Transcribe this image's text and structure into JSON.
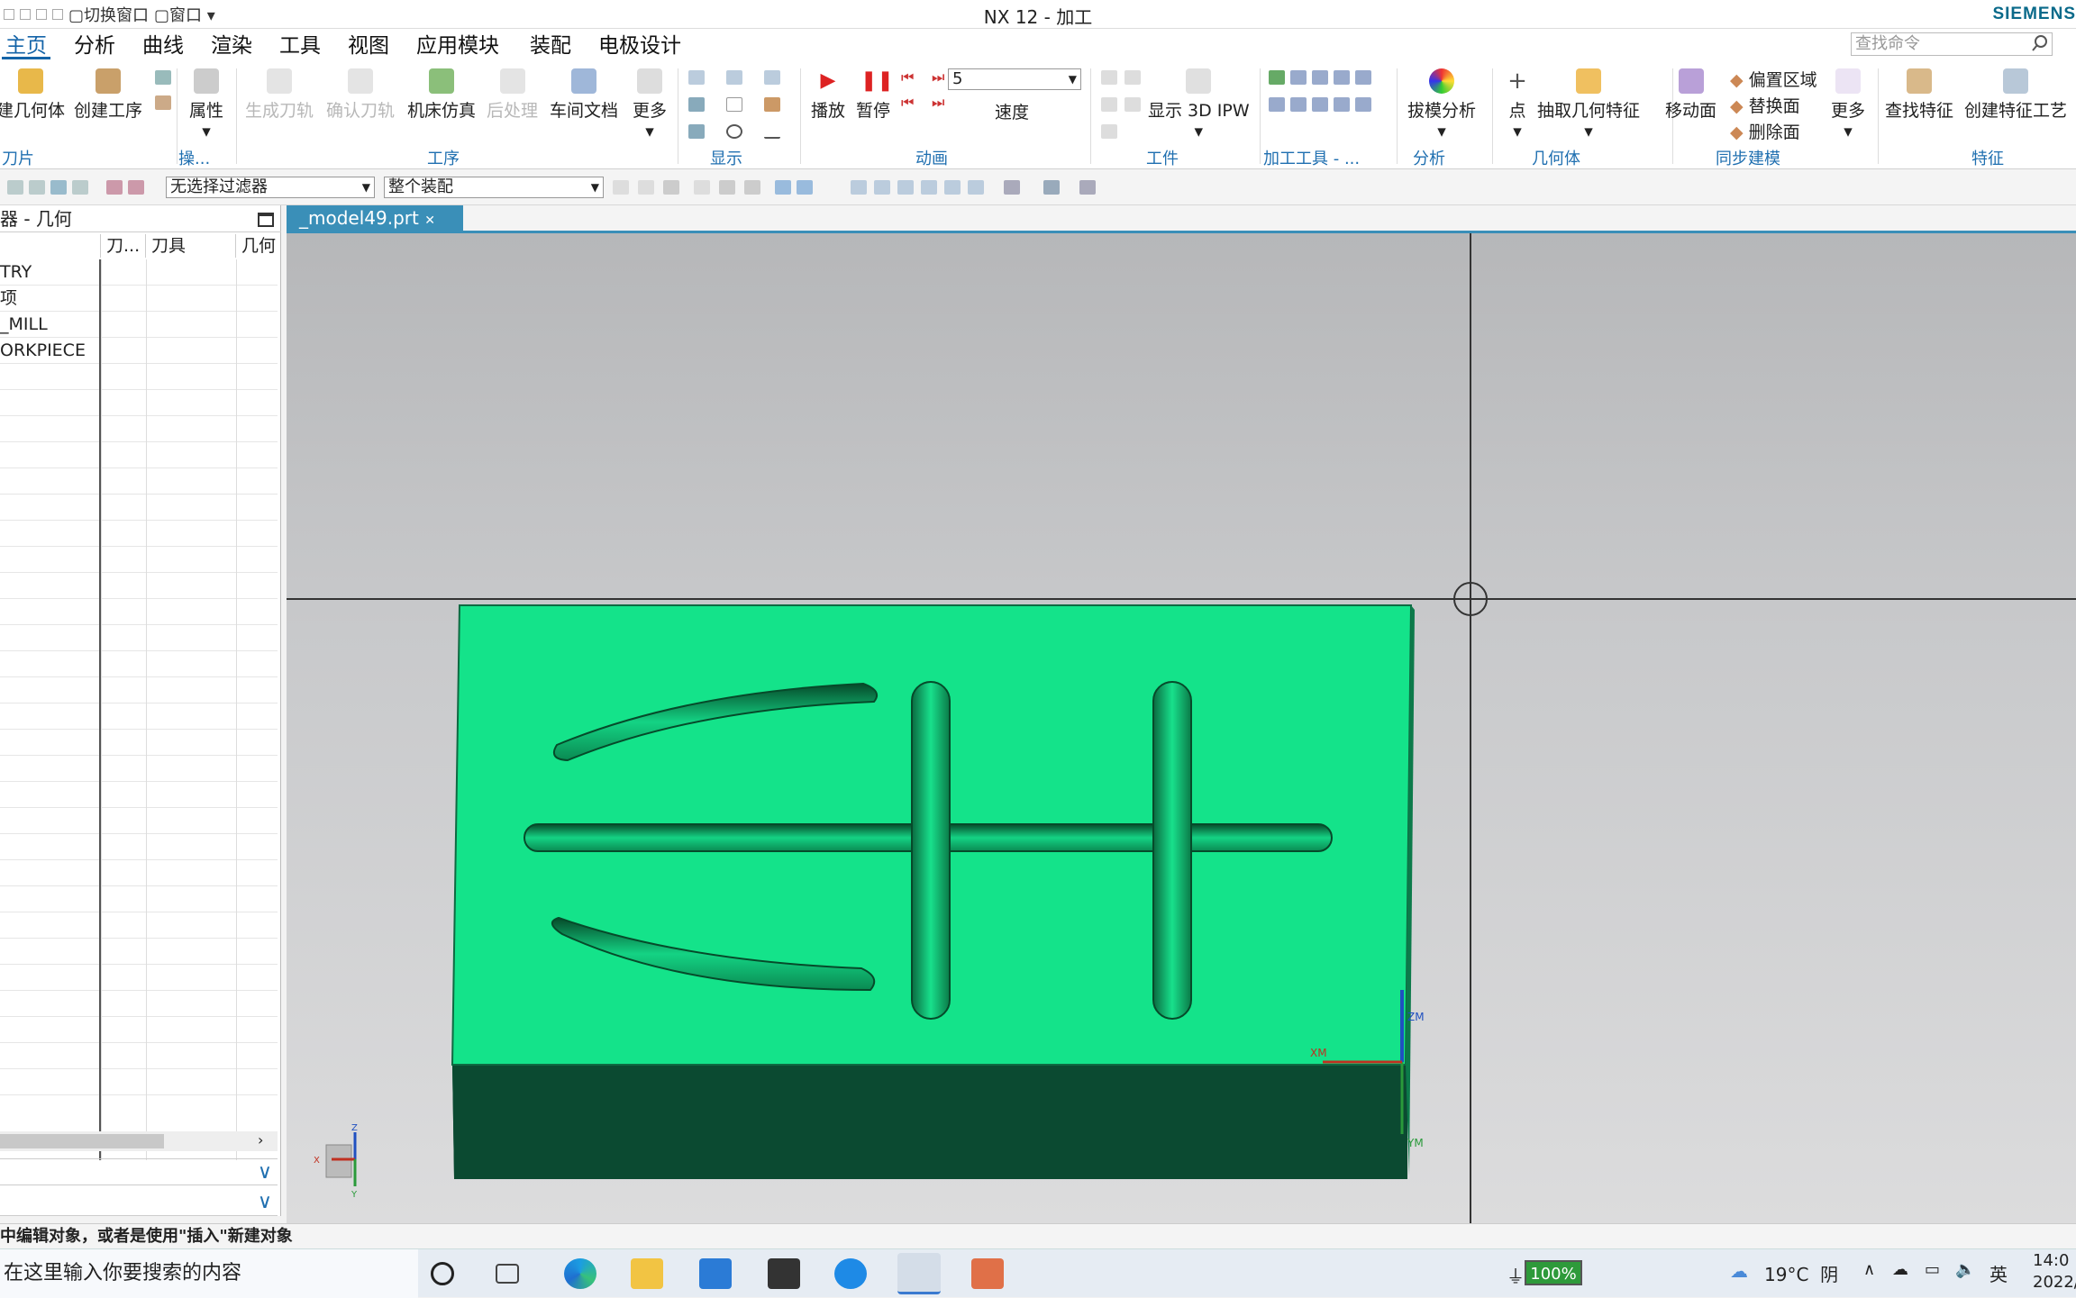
{
  "app": {
    "title": "NX 12 - 加工",
    "brand": "SIEMENS"
  },
  "qat": {
    "switch_window": "切换窗口",
    "window": "窗口"
  },
  "menu": {
    "items": [
      "主页",
      "分析",
      "曲线",
      "渲染",
      "工具",
      "视图",
      "应用模块",
      "装配",
      "电极设计"
    ],
    "search_placeholder": "查找命令"
  },
  "ribbon": {
    "buttons": {
      "create_geometry": "建几何体",
      "create_operation": "创建工序",
      "properties": "属性",
      "generate_path": "生成刀轨",
      "verify_path": "确认刀轨",
      "machine_sim": "机床仿真",
      "postprocess": "后处理",
      "shop_doc": "车间文档",
      "more": "更多",
      "play": "播放",
      "pause": "暂停",
      "speed_value": "5",
      "speed": "速度",
      "show_3d_ipw": "显示 3D IPW",
      "draft_analysis": "拔模分析",
      "point": "点",
      "extract_geometry": "抽取几何特征",
      "move_face": "移动面",
      "offset_region": "偏置区域",
      "replace_face": "替换面",
      "delete_face": "删除面",
      "more2": "更多",
      "find_feature": "查找特征",
      "create_feature_process": "创建特征工艺"
    },
    "groups": {
      "tool": "刀片",
      "ops": "操...",
      "operation": "工序",
      "display": "显示",
      "animation": "动画",
      "workpiece": "工件",
      "machining_tools": "加工工具 - ...",
      "analysis": "分析",
      "geometry": "几何体",
      "sync_modeling": "同步建模",
      "feature": "特征"
    }
  },
  "toolbar2": {
    "filter": "无选择过滤器",
    "assembly": "整个装配"
  },
  "navigator": {
    "title": "器 - 几何",
    "columns": [
      "刀...",
      "刀具",
      "几何"
    ],
    "rows": [
      "TRY",
      "项",
      "_MILL",
      "ORKPIECE"
    ]
  },
  "document": {
    "tab": "_model49.prt"
  },
  "viewport": {
    "wcs_labels": {
      "xm": "XM",
      "ym": "YM",
      "zm": "ZM"
    },
    "triad": {
      "x": "X",
      "y": "Y",
      "z": "Z"
    },
    "colors": {
      "part_top": "#14e38a",
      "part_side": "#0a4a30",
      "bg": "#c8c9cb"
    }
  },
  "status": {
    "prompt": "中编辑对象，或者是使用\"插入\"新建对象"
  },
  "taskbar": {
    "search": "在这里输入你要搜索的内容",
    "battery": "100%",
    "weather": "19°C  阴",
    "ime": "英",
    "time": "14:0",
    "date": "2022/"
  }
}
